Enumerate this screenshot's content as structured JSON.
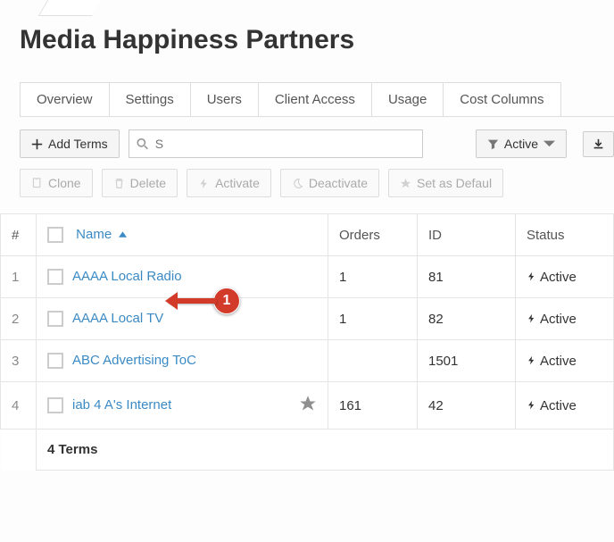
{
  "title": "Media Happiness Partners",
  "tabs": [
    "Overview",
    "Settings",
    "Users",
    "Client Access",
    "Usage",
    "Cost Columns"
  ],
  "toolbar": {
    "add_terms": "Add Terms",
    "search_placeholder": "S",
    "filter_label": "Active",
    "clone": "Clone",
    "delete": "Delete",
    "activate": "Activate",
    "deactivate": "Deactivate",
    "set_default": "Set as Defaul"
  },
  "columns": {
    "rownum": "#",
    "name": "Name",
    "orders": "Orders",
    "id": "ID",
    "status": "Status"
  },
  "rows": [
    {
      "n": "1",
      "name": "AAAA Local Radio",
      "orders": "1",
      "id": "81",
      "status": "Active",
      "starred": false
    },
    {
      "n": "2",
      "name": "AAAA Local TV",
      "orders": "1",
      "id": "82",
      "status": "Active",
      "starred": false
    },
    {
      "n": "3",
      "name": "ABC Advertising ToC",
      "orders": "",
      "id": "1501",
      "status": "Active",
      "starred": false
    },
    {
      "n": "4",
      "name": "iab 4 A's Internet",
      "orders": "161",
      "id": "42",
      "status": "Active",
      "starred": true
    }
  ],
  "footer": "4 Terms",
  "annotation": {
    "badge": "1"
  }
}
